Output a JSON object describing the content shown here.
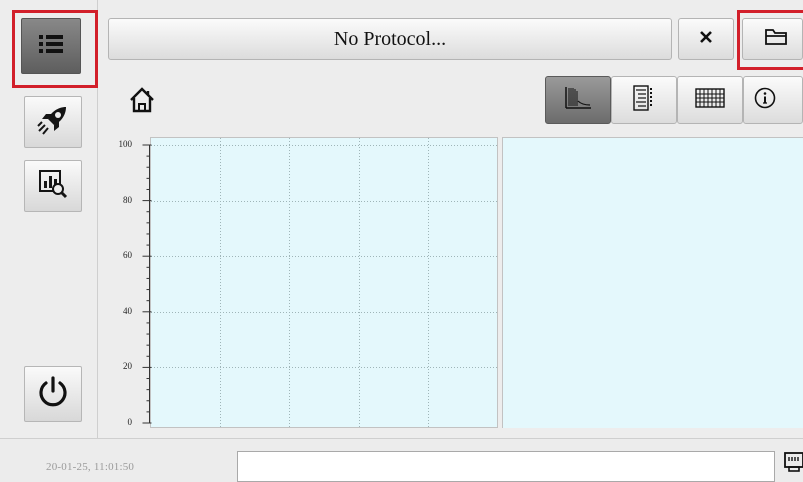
{
  "header": {
    "title": "No Protocol..."
  },
  "sidebar": {
    "items": [
      {
        "name": "menu",
        "icon": "list-icon"
      },
      {
        "name": "run",
        "icon": "rocket-icon"
      },
      {
        "name": "analysis",
        "icon": "chart-search-icon"
      },
      {
        "name": "power",
        "icon": "power-icon"
      }
    ]
  },
  "toolbar": {
    "close_icon": "close-icon",
    "open_icon": "folder-open-icon",
    "home_icon": "home-icon",
    "views": [
      "plot-view-icon",
      "tree-view-icon",
      "grid-view-icon",
      "info-icon"
    ]
  },
  "plot": {
    "y_ticks": [
      "100",
      "80",
      "60",
      "40",
      "20",
      "0"
    ]
  },
  "footer": {
    "timestamp": "20-01-25, 11:01:50",
    "network_icon": "network-icon"
  },
  "colors": {
    "highlight": "#d21f2a",
    "plot_bg": "#e4f8fc",
    "active_button": "#6a6a6a"
  }
}
